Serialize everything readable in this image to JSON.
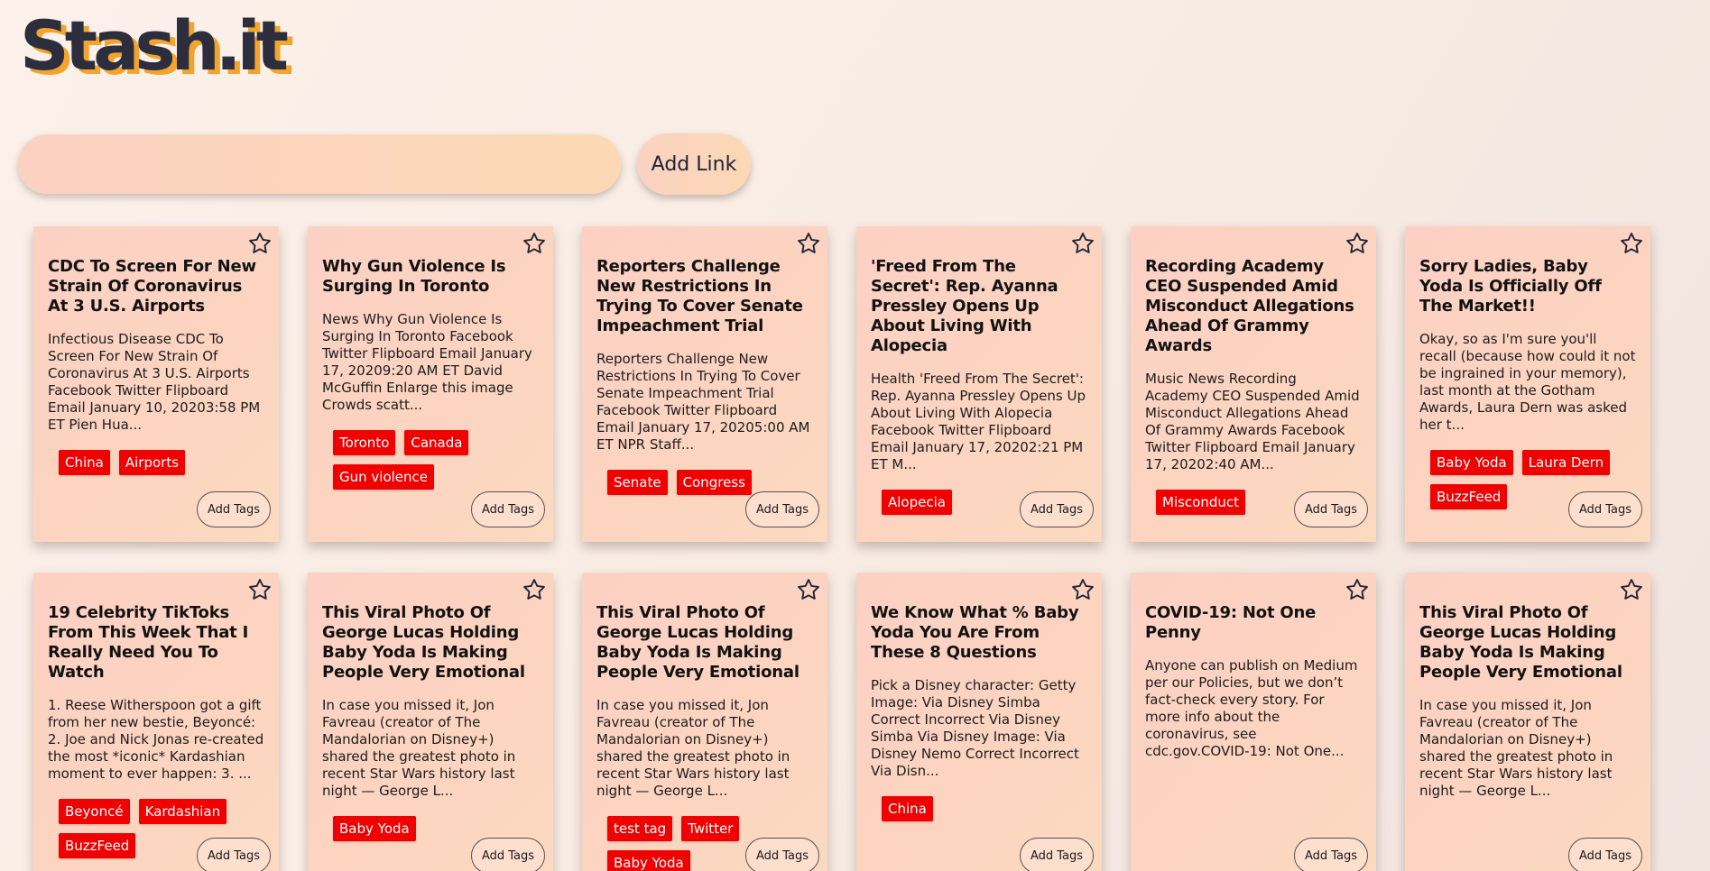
{
  "app": {
    "logo": "Stash.it"
  },
  "search": {
    "value": "",
    "placeholder": "",
    "add_link_label": "Add Link"
  },
  "common": {
    "add_tags_label": "Add Tags"
  },
  "cards": [
    {
      "title": "CDC To Screen For New Strain Of Coronavirus At 3 U.S. Airports",
      "description": "Infectious Disease CDC To Screen For New Strain Of Coronavirus At 3 U.S. Airports Facebook Twitter Flipboard Email January 10, 20203:58 PM ET Pien Hua...",
      "tags": [
        "China",
        "Airports"
      ]
    },
    {
      "title": "Why Gun Violence Is Surging In Toronto",
      "description": "News Why Gun Violence Is Surging In Toronto Facebook Twitter Flipboard Email January 17, 20209:20 AM ET David McGuffin Enlarge this image Crowds scatt...",
      "tags": [
        "Toronto",
        "Canada",
        "Gun violence"
      ]
    },
    {
      "title": "Reporters Challenge New Restrictions In Trying To Cover Senate Impeachment Trial",
      "description": "Reporters Challenge New Restrictions In Trying To Cover Senate Impeachment Trial Facebook Twitter Flipboard Email January 17, 20205:00 AM ET NPR Staff...",
      "tags": [
        "Senate",
        "Congress"
      ]
    },
    {
      "title": "'Freed From The Secret': Rep. Ayanna Pressley Opens Up About Living With Alopecia",
      "description": "Health 'Freed From The Secret': Rep. Ayanna Pressley Opens Up About Living With Alopecia Facebook Twitter Flipboard Email January 17, 20202:21 PM ET M...",
      "tags": [
        "Alopecia"
      ]
    },
    {
      "title": "Recording Academy CEO Suspended Amid Misconduct Allegations Ahead Of Grammy Awards",
      "description": "Music News Recording Academy CEO Suspended Amid Misconduct Allegations Ahead Of Grammy Awards Facebook Twitter Flipboard Email January 17, 20202:40 AM...",
      "tags": [
        "Misconduct"
      ]
    },
    {
      "title": "Sorry Ladies, Baby Yoda Is Officially Off The Market!!",
      "description": "Okay, so as I'm sure you'll recall (because how could it not be ingrained in your memory), last month at the Gotham Awards, Laura Dern was asked her t...",
      "tags": [
        "Baby Yoda",
        "Laura Dern",
        "BuzzFeed"
      ]
    },
    {
      "title": "19 Celebrity TikToks From This Week That I Really Need You To Watch",
      "description": "1. Reese Witherspoon got a gift from her new bestie, Beyoncé: 2. Joe and Nick Jonas re-created the most *iconic* Kardashian moment to ever happen: 3. ...",
      "tags": [
        "Beyoncé",
        "Kardashian",
        "BuzzFeed"
      ]
    },
    {
      "title": "This Viral Photo Of George Lucas Holding Baby Yoda Is Making People Very Emotional",
      "description": "In case you missed it, Jon Favreau (creator of The Mandalorian on Disney+) shared the greatest photo in recent Star Wars history last night — George L...",
      "tags": [
        "Baby Yoda"
      ]
    },
    {
      "title": "This Viral Photo Of George Lucas Holding Baby Yoda Is Making People Very Emotional",
      "description": "In case you missed it, Jon Favreau (creator of The Mandalorian on Disney+) shared the greatest photo in recent Star Wars history last night — George L...",
      "tags": [
        "test tag",
        "Twitter",
        "Baby Yoda"
      ]
    },
    {
      "title": "We Know What % Baby Yoda You Are From These 8 Questions",
      "description": "Pick a Disney character: Getty Image: Via Disney Simba Correct Incorrect Via Disney Simba Via Disney Image: Via Disney Nemo Correct Incorrect Via Disn...",
      "tags": [
        "China"
      ]
    },
    {
      "title": "COVID-19: Not One Penny",
      "description": "Anyone can publish on Medium per our Policies, but we don’t fact-check every story. For more info about the coronavirus, see cdc.gov.COVID-19: Not One...",
      "tags": []
    },
    {
      "title": "This Viral Photo Of George Lucas Holding Baby Yoda Is Making People Very Emotional",
      "description": "In case you missed it, Jon Favreau (creator of The Mandalorian on Disney+) shared the greatest photo in recent Star Wars history last night — George L...",
      "tags": []
    }
  ],
  "colors": {
    "tag": "#f00000",
    "logo_text": "#2c2d3d",
    "logo_shadow": "#f2a42d"
  },
  "icons": {
    "favorite": "star-outline-icon"
  }
}
